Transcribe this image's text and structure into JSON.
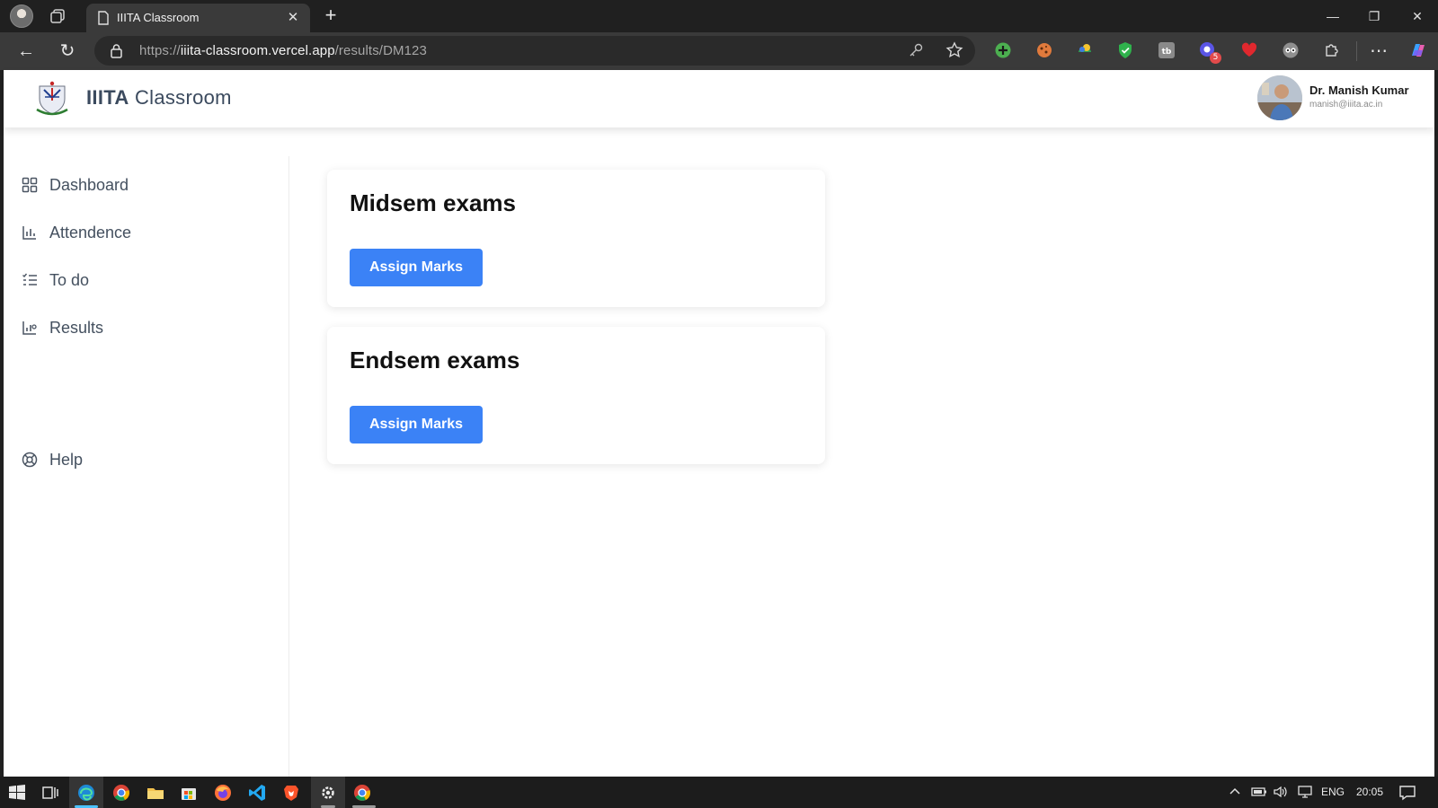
{
  "browser": {
    "tab_title": "IIITA Classroom",
    "url_prefix": "https://",
    "url_host": "iiita-classroom.vercel.app",
    "url_path": "/results/DM123",
    "extension_badge": "5"
  },
  "header": {
    "brand_bold": "IIITA",
    "brand_rest": "Classroom",
    "user_name": "Dr. Manish Kumar",
    "user_email": "manish@iiita.ac.in"
  },
  "sidebar": {
    "items": [
      {
        "label": "Dashboard",
        "icon": "dashboard-icon"
      },
      {
        "label": "Attendence",
        "icon": "bar-chart-icon"
      },
      {
        "label": "To do",
        "icon": "todo-list-icon"
      },
      {
        "label": "Results",
        "icon": "results-chart-icon"
      }
    ],
    "help": {
      "label": "Help",
      "icon": "lifebuoy-icon"
    }
  },
  "main": {
    "cards": [
      {
        "title": "Midsem exams",
        "button_label": "Assign Marks"
      },
      {
        "title": "Endsem exams",
        "button_label": "Assign Marks"
      }
    ]
  },
  "taskbar": {
    "language": "ENG",
    "time": "20:05"
  },
  "colors": {
    "primary_button": "#3b82f6",
    "browser_chrome": "#202020",
    "taskbar_active_indicator": "#4cc2ff"
  }
}
